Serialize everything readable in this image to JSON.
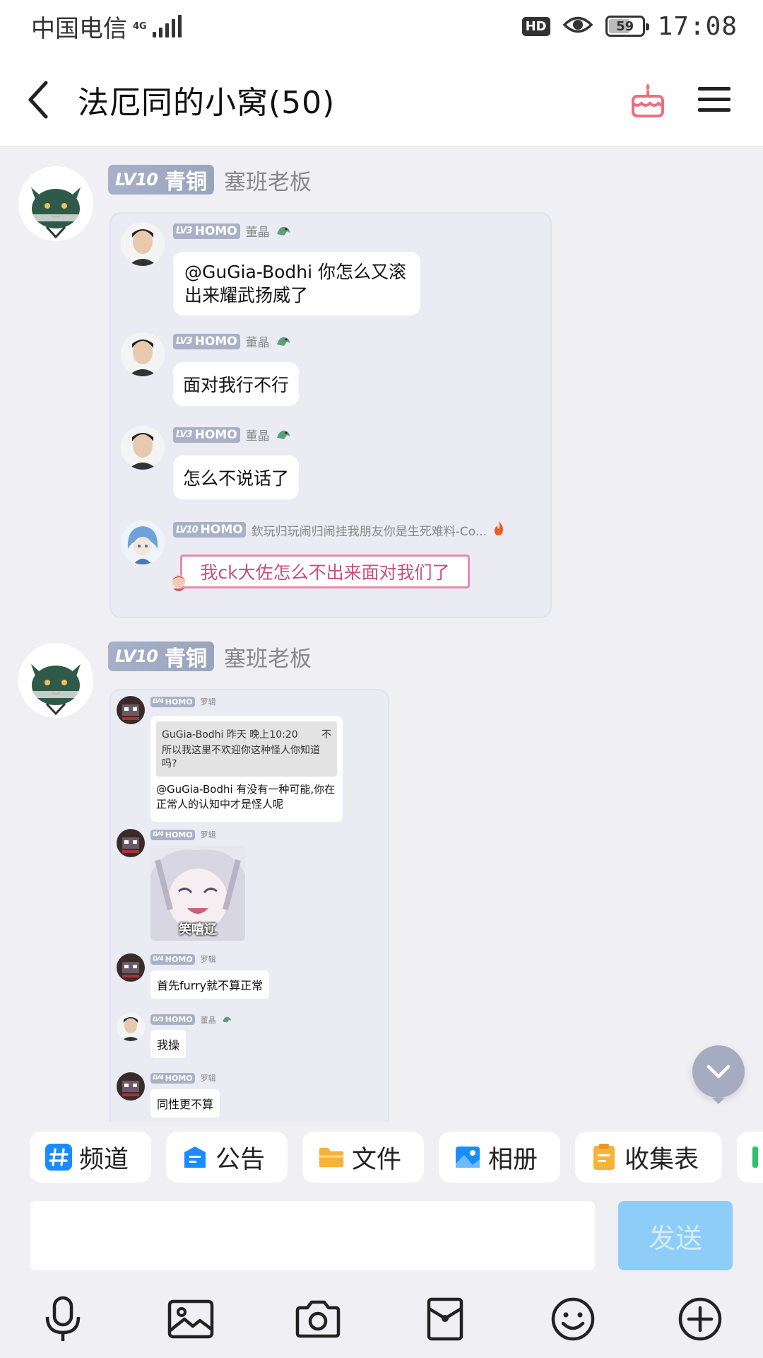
{
  "status_bar": {
    "carrier": "中国电信",
    "network": "4G",
    "hd": "HD",
    "battery": "59",
    "time": "17:08"
  },
  "header": {
    "title": "法厄同的小窝(50)",
    "icons": [
      "back-icon",
      "cake-icon",
      "menu-icon"
    ]
  },
  "messages": [
    {
      "level": "LV10",
      "rank": "青铜",
      "sender": "塞班老板",
      "forward": [
        {
          "level": "LV3",
          "title": "HOMO",
          "name": "董晶",
          "text": "@GuGia-Bodhi 你怎么又滚出来耀武扬威了"
        },
        {
          "level": "LV3",
          "title": "HOMO",
          "name": "董晶",
          "text": "面对我行不行"
        },
        {
          "level": "LV3",
          "title": "HOMO",
          "name": "董晶",
          "text": "怎么不说话了"
        },
        {
          "level": "LV10",
          "title": "HOMO",
          "name": "欽玩归玩闹归闹挂我朋友你是生死难料-Co...",
          "text": "我ck大佐怎么不出来面对我们了"
        }
      ]
    },
    {
      "level": "LV10",
      "rank": "青铜",
      "sender": "塞班老板",
      "forward": [
        {
          "level": "LV4",
          "title": "HOMO",
          "name": "罗辑",
          "quote_header": "GuGia-Bodhi 昨天 晚上10:20",
          "quote_close": "不",
          "quote_text": "所以我这里不欢迎你这种怪人你知道吗?",
          "text": "@GuGia-Bodhi 有没有一种可能,你在正常人的认知中才是怪人呢"
        },
        {
          "level": "LV4",
          "title": "HOMO",
          "name": "罗辑",
          "sticker_caption": "笑嘻辽"
        },
        {
          "level": "LV4",
          "title": "HOMO",
          "name": "罗辑",
          "text": "首先furry就不算正常"
        },
        {
          "level": "LV3",
          "title": "HOMO",
          "name": "董晶",
          "text": "我操"
        },
        {
          "level": "LV4",
          "title": "HOMO",
          "name": "罗辑",
          "text": "同性更不算"
        }
      ]
    }
  ],
  "shortcuts": [
    {
      "label": "频道",
      "icon": "hash-icon",
      "color": "#1a8cff"
    },
    {
      "label": "公告",
      "icon": "announcement-icon",
      "color": "#1a8cff"
    },
    {
      "label": "文件",
      "icon": "folder-icon",
      "color": "#f8b13a"
    },
    {
      "label": "相册",
      "icon": "album-icon",
      "color": "#1a8cff"
    },
    {
      "label": "收集表",
      "icon": "clipboard-icon",
      "color": "#f8b13a"
    }
  ],
  "composer": {
    "placeholder": "",
    "send_label": "发送"
  },
  "toolbar": [
    "microphone-icon",
    "image-icon",
    "camera-icon",
    "red-packet-icon",
    "emoji-icon",
    "plus-icon"
  ]
}
